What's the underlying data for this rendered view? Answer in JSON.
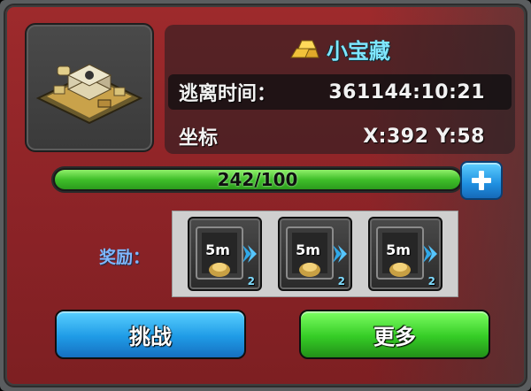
{
  "title": {
    "text": "小宝藏",
    "icon": "gold-bars-icon"
  },
  "info": {
    "escape_label": "逃离时间：",
    "escape_value": "361144:10:21",
    "coords_label": "坐标",
    "coords_value": "X:392 Y:58"
  },
  "progress": {
    "text": "242/100",
    "fill_fraction": 1.0
  },
  "rewards": {
    "label": "奖励：",
    "items": [
      {
        "label": "5m",
        "count": "2",
        "icon": "speedup-crate-icon"
      },
      {
        "label": "5m",
        "count": "2",
        "icon": "speedup-crate-icon"
      },
      {
        "label": "5m",
        "count": "2",
        "icon": "speedup-crate-icon"
      }
    ]
  },
  "buttons": {
    "challenge": "挑战",
    "more": "更多"
  },
  "colors": {
    "panel_red": "#9e2a2c",
    "title_cyan": "#7fe6ff",
    "reward_blue": "#7fb7ff",
    "progress_green": "#3fbf2a",
    "button_blue": "#1f9be6",
    "button_green": "#35cc26"
  }
}
